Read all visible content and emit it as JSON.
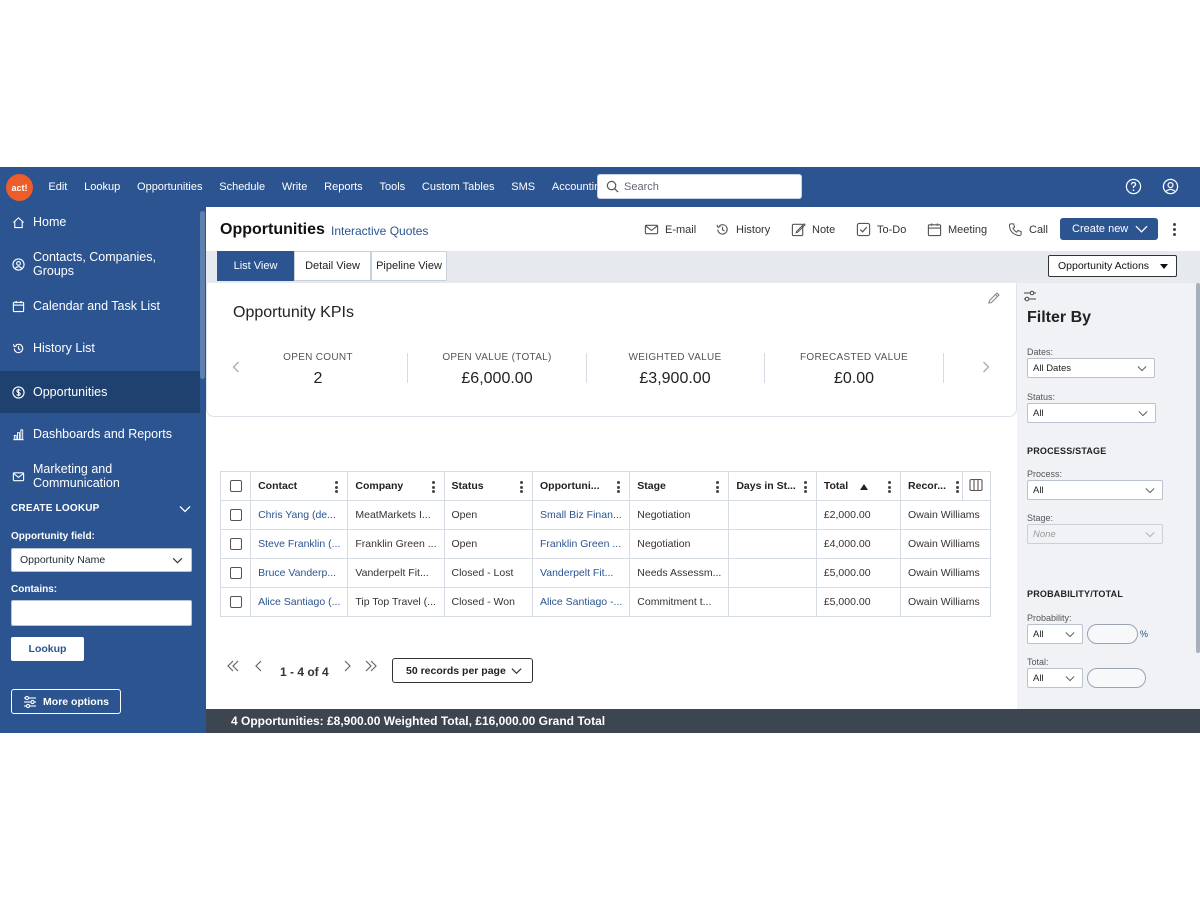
{
  "app": {
    "logo_text": "act!",
    "menu": [
      "Edit",
      "Lookup",
      "Opportunities",
      "Schedule",
      "Write",
      "Reports",
      "Tools",
      "Custom Tables",
      "SMS",
      "Accounting"
    ],
    "search_placeholder": "Search",
    "brand_color": "#2b5491",
    "logo_color": "#ec5d2a"
  },
  "sidebar": {
    "items": [
      {
        "label": "Home",
        "icon": "home-icon"
      },
      {
        "label": "Contacts, Companies, Groups",
        "icon": "contacts-icon"
      },
      {
        "label": "Calendar and Task List",
        "icon": "calendar-icon"
      },
      {
        "label": "History List",
        "icon": "history-icon"
      },
      {
        "label": "Opportunities",
        "icon": "dollar-icon",
        "active": true
      },
      {
        "label": "Dashboards and Reports",
        "icon": "chart-icon"
      },
      {
        "label": "Marketing and Communication",
        "icon": "mail-icon"
      }
    ],
    "create_lookup": "CREATE LOOKUP",
    "opportunity_field_label": "Opportunity field:",
    "opportunity_field_value": "Opportunity Name",
    "contains_label": "Contains:",
    "contains_value": "",
    "lookup_button": "Lookup",
    "more_options": "More options"
  },
  "header": {
    "title": "Opportunities",
    "quotes_link": "Interactive Quotes",
    "actions": {
      "email": "E-mail",
      "history": "History",
      "note": "Note",
      "todo": "To-Do",
      "meeting": "Meeting",
      "call": "Call"
    },
    "create_new": "Create new"
  },
  "tabs": [
    "List View",
    "Detail View",
    "Pipeline View"
  ],
  "opportunity_actions": "Opportunity Actions",
  "kpi": {
    "title": "Opportunity KPIs",
    "items": [
      {
        "label": "OPEN COUNT",
        "value": "2"
      },
      {
        "label": "OPEN VALUE (TOTAL)",
        "value": "£6,000.00"
      },
      {
        "label": "WEIGHTED VALUE",
        "value": "£3,900.00"
      },
      {
        "label": "FORECASTED VALUE",
        "value": "£0.00"
      }
    ]
  },
  "grid": {
    "columns": [
      "Contact",
      "Company",
      "Status",
      "Opportuni...",
      "Stage",
      "Days in St...",
      "Total",
      "Recor..."
    ],
    "sorted_column": "Total",
    "rows": [
      [
        "Chris Yang (de...",
        "MeatMarkets I...",
        "Open",
        "Small Biz Finan...",
        "Negotiation",
        "",
        "£2,000.00",
        "Owain Williams"
      ],
      [
        "Steve Franklin (...",
        "Franklin Green ...",
        "Open",
        "Franklin Green ...",
        "Negotiation",
        "",
        "£4,000.00",
        "Owain Williams"
      ],
      [
        "Bruce Vanderp...",
        "Vanderpelt Fit...",
        "Closed - Lost",
        "Vanderpelt Fit...",
        "Needs Assessm...",
        "",
        "£5,000.00",
        "Owain Williams"
      ],
      [
        "Alice Santiago (...",
        "Tip Top Travel (...",
        "Closed - Won",
        "Alice Santiago -...",
        "Commitment t...",
        "",
        "£5,000.00",
        "Owain Williams"
      ]
    ]
  },
  "pager": {
    "count": "1 - 4 of 4",
    "per_page": "50 records per page"
  },
  "footer": "4 Opportunities: £8,900.00 Weighted Total, £16,000.00 Grand Total",
  "filter": {
    "title": "Filter By",
    "dates_label": "Dates:",
    "dates_value": "All Dates",
    "status_label": "Status:",
    "status_value": "All",
    "process_section": "PROCESS/STAGE",
    "process_label": "Process:",
    "process_value": "All",
    "stage_label": "Stage:",
    "stage_value": "None",
    "prob_section": "PROBABILITY/TOTAL",
    "probability_label": "Probability:",
    "probability_value": "All",
    "percent": "%",
    "total_label": "Total:",
    "total_value": "All"
  }
}
